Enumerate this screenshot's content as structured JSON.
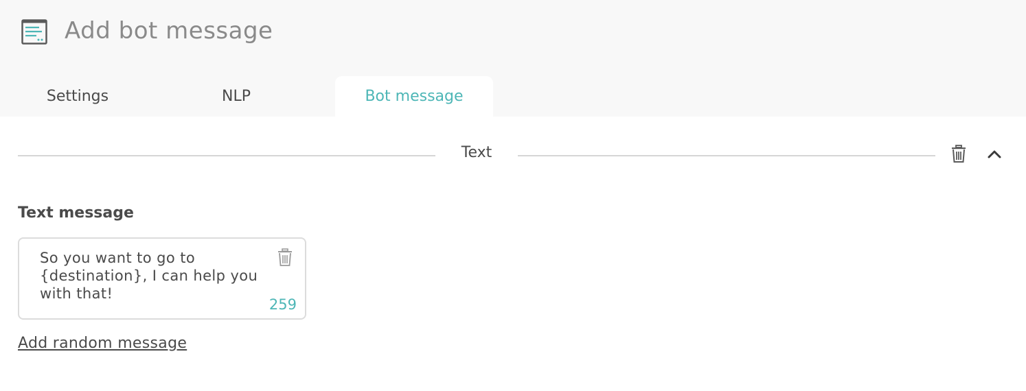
{
  "header": {
    "title": "Add bot message",
    "icon": "message-window-icon"
  },
  "tabs": [
    {
      "label": "Settings",
      "active": false
    },
    {
      "label": "NLP",
      "active": false
    },
    {
      "label": "Bot message",
      "active": true
    }
  ],
  "section": {
    "title": "Text",
    "delete_icon": "trash-icon",
    "collapse_icon": "chevron-up-icon"
  },
  "text_message": {
    "label": "Text message",
    "value": "So you want to go to {destination}, I can help you with that!",
    "remaining_chars": "259",
    "delete_icon": "trash-icon"
  },
  "add_random_label": "Add random message",
  "colors": {
    "accent": "#4db6b6",
    "header_bg": "#f8f8f8",
    "text": "#4a4a4a",
    "muted": "#8a8a8a"
  }
}
